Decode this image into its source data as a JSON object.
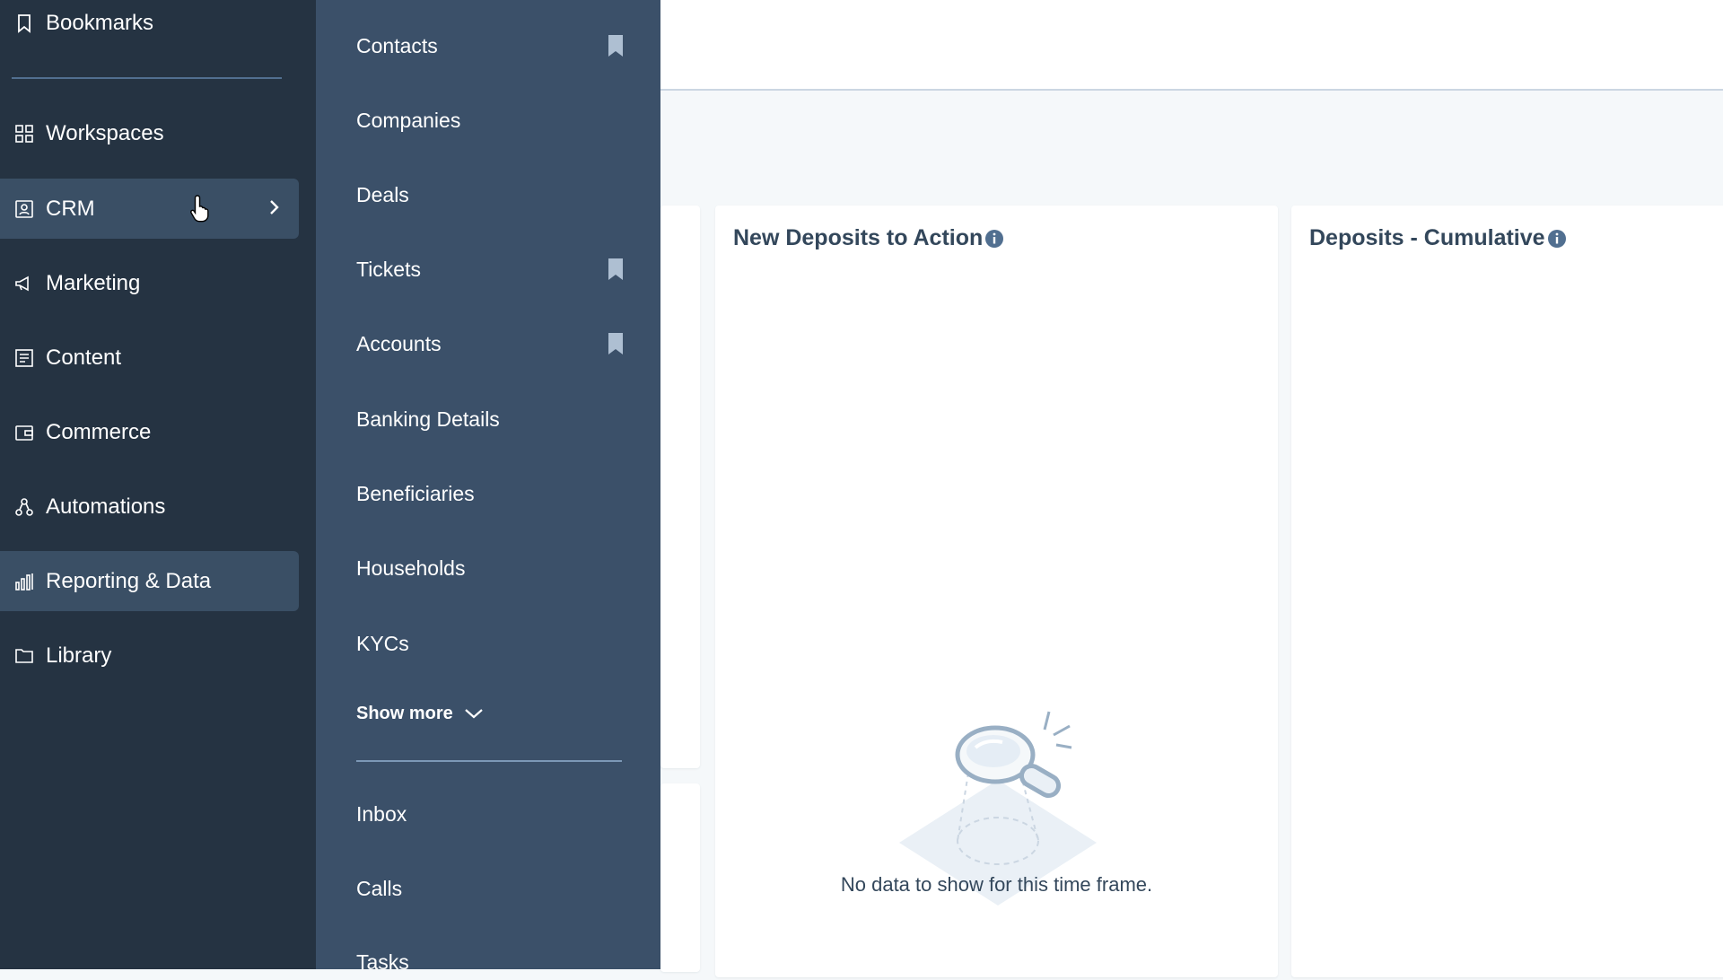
{
  "sidebar": {
    "bookmarks_label": "Bookmarks",
    "items": [
      {
        "label": "Workspaces",
        "icon": "grid-icon"
      },
      {
        "label": "CRM",
        "icon": "contact-card-icon",
        "active": true
      },
      {
        "label": "Marketing",
        "icon": "megaphone-icon"
      },
      {
        "label": "Content",
        "icon": "document-icon"
      },
      {
        "label": "Commerce",
        "icon": "wallet-icon"
      },
      {
        "label": "Automations",
        "icon": "workflow-icon"
      },
      {
        "label": "Reporting & Data",
        "icon": "bar-chart-icon",
        "highlighted": true
      },
      {
        "label": "Library",
        "icon": "folder-icon"
      }
    ]
  },
  "crm_menu": {
    "items": [
      {
        "label": "Contacts",
        "bookmarked": true
      },
      {
        "label": "Companies",
        "bookmarked": false
      },
      {
        "label": "Deals",
        "bookmarked": false
      },
      {
        "label": "Tickets",
        "bookmarked": true
      },
      {
        "label": "Accounts",
        "bookmarked": true
      },
      {
        "label": "Banking Details",
        "bookmarked": false
      },
      {
        "label": "Beneficiaries",
        "bookmarked": false
      },
      {
        "label": "Households",
        "bookmarked": false
      },
      {
        "label": "KYCs",
        "bookmarked": false
      }
    ],
    "show_more_label": "Show more",
    "secondary_items": [
      {
        "label": "Inbox"
      },
      {
        "label": "Calls"
      },
      {
        "label": "Tasks"
      }
    ]
  },
  "dashboard": {
    "cards": [
      {
        "title": "New Deposits to Action",
        "empty_message": "No data to show for this time frame."
      },
      {
        "title": "Deposits - Cumulative"
      }
    ]
  },
  "colors": {
    "sidebar_bg": "#253342",
    "flyout_bg": "#3b5069",
    "active_bg": "#3a4f65",
    "page_bg": "#f5f8fa"
  }
}
